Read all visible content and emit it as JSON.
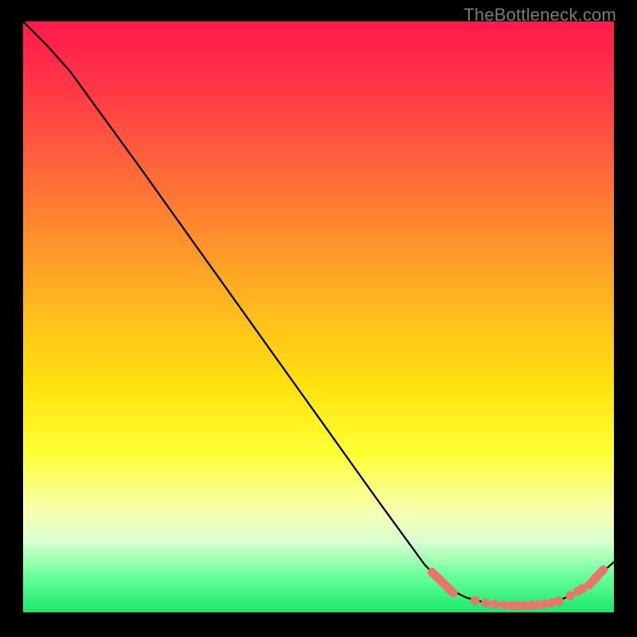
{
  "watermark": "TheBottleneck.com",
  "chart_data": {
    "type": "line",
    "title": "",
    "xlabel": "",
    "ylabel": "",
    "xlim": [
      0,
      100
    ],
    "ylim": [
      0,
      100
    ],
    "grid": false,
    "series": [
      {
        "name": "curve",
        "x": [
          0,
          4,
          8,
          12,
          20,
          30,
          40,
          50,
          60,
          68,
          72,
          75,
          78,
          82,
          86,
          90,
          93,
          96,
          100
        ],
        "y": [
          100,
          96,
          91.5,
          86,
          75,
          61,
          47,
          33,
          19,
          8,
          4,
          2.5,
          1.7,
          1.2,
          1.2,
          1.7,
          3,
          5,
          8.5
        ]
      }
    ],
    "markers": {
      "pills": [
        {
          "x1": 69.2,
          "y1": 6.8,
          "x2": 72.8,
          "y2": 3.3
        },
        {
          "x1": 95.8,
          "y1": 4.6,
          "x2": 98.2,
          "y2": 7.2
        }
      ],
      "dots_x": [
        76.5,
        78.3,
        79.8,
        81.3,
        82.6,
        83.7,
        84.9,
        86.0,
        87.2,
        88.3,
        89.5,
        90.7,
        92.6,
        93.9,
        94.7
      ],
      "dots_y": [
        2.0,
        1.6,
        1.35,
        1.2,
        1.15,
        1.15,
        1.15,
        1.2,
        1.25,
        1.4,
        1.6,
        1.9,
        2.8,
        3.6,
        4.0
      ],
      "radius": 5.2
    }
  }
}
